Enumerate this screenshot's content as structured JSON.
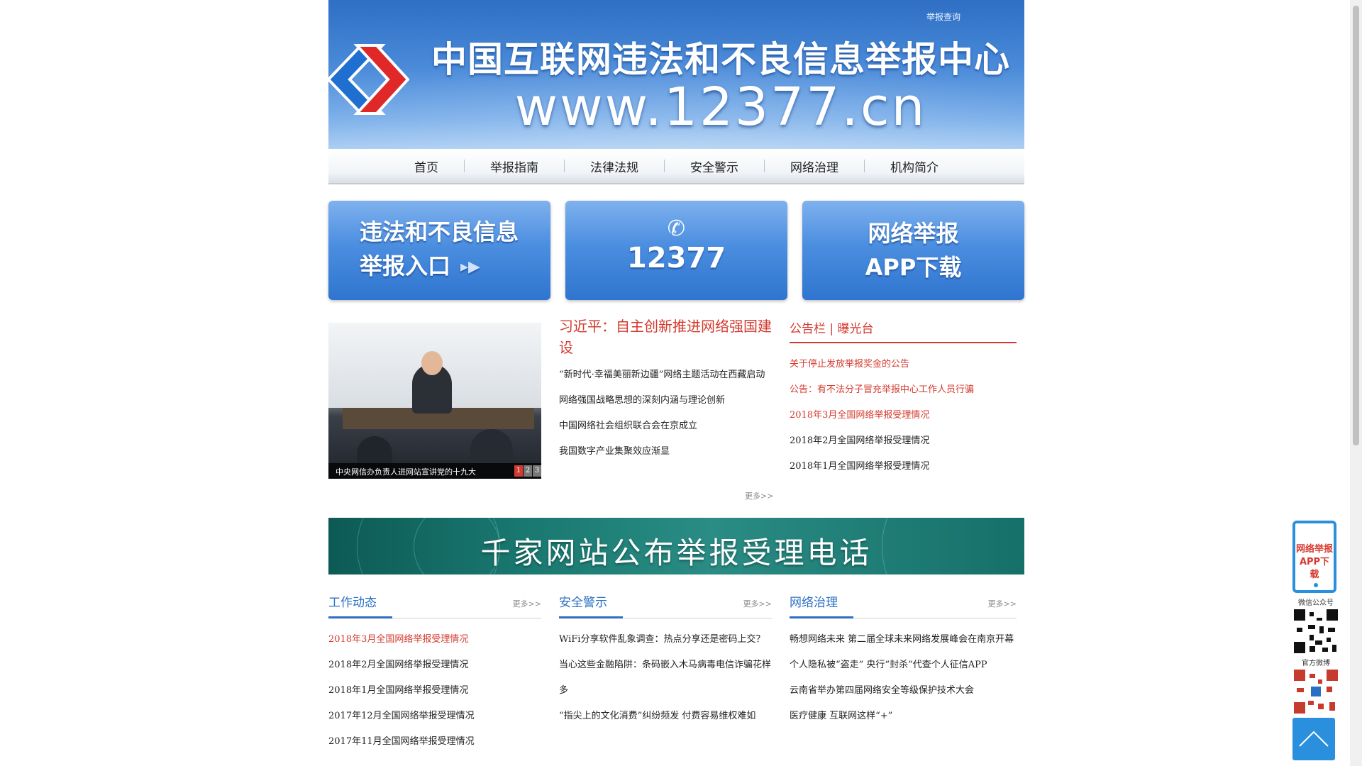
{
  "header": {
    "report_query": "举报查询",
    "title": "中国互联网违法和不良信息举报中心",
    "url": "www.12377.cn"
  },
  "nav": {
    "items": [
      "首页",
      "举报指南",
      "法律法规",
      "安全警示",
      "网络治理",
      "机构简介"
    ]
  },
  "tiles": {
    "report_entry": {
      "line1": "违法和不良信息",
      "line2": "举报入口"
    },
    "hotline": {
      "number": "12377"
    },
    "app": {
      "line1": "网络举报",
      "line2": "APP下载"
    }
  },
  "slideshow": {
    "caption": "中央网信办负责人进网站宣讲党的十九大",
    "pages": [
      "1",
      "2",
      "3"
    ],
    "active": 1
  },
  "headline": {
    "title": "习近平：自主创新推进网络强国建设",
    "items": [
      "“新时代·幸福美丽新边疆”网络主题活动在西藏启动",
      "网络强国战略思想的深刻内涵与理论创新",
      "中国网络社会组织联合会在京成立",
      "我国数字产业集聚效应渐显"
    ],
    "more": "更多>>"
  },
  "bulletin": {
    "title": "公告栏 | 曝光台",
    "items": [
      "关于停止发放举报奖金的公告",
      "公告：有不法分子冒充举报中心工作人员行骗",
      "2018年3月全国网络举报受理情况",
      "2018年2月全国网络举报受理情况",
      "2018年1月全国网络举报受理情况"
    ]
  },
  "banner2": {
    "text": "千家网站公布举报受理电话"
  },
  "columns": [
    {
      "title": "工作动态",
      "more": "更多>>",
      "items": [
        "2018年3月全国网络举报受理情况",
        "2018年2月全国网络举报受理情况",
        "2018年1月全国网络举报受理情况",
        "2017年12月全国网络举报受理情况",
        "2017年11月全国网络举报受理情况"
      ]
    },
    {
      "title": "安全警示",
      "more": "更多>>",
      "items": [
        "WiFi分享软件乱象调查：热点分享还是密码上交？",
        "当心这些金融陷阱：条码嵌入木马病毒电信诈骗花样多",
        "“指尖上的文化消费”纠纷频发 付费容易维权难如"
      ]
    },
    {
      "title": "网络治理",
      "more": "更多>>",
      "items": [
        "畅想网络未来 第二届全球未来网络发展峰会在南京开幕",
        "个人隐私被“盗走” 央行“封杀”代查个人征信APP",
        "云南省举办第四届网络安全等级保护技术大会",
        "医疗健康 互联网这样“+”"
      ]
    }
  ],
  "sidebar": {
    "app_line1": "网络举报",
    "app_line2": "APP下载",
    "wechat_label": "微信公众号",
    "weibo_label": "官方微博"
  },
  "colors": {
    "accent_blue": "#2a6fc4",
    "accent_red": "#d43a2f",
    "sidebar_blue": "#2a8fdc"
  }
}
